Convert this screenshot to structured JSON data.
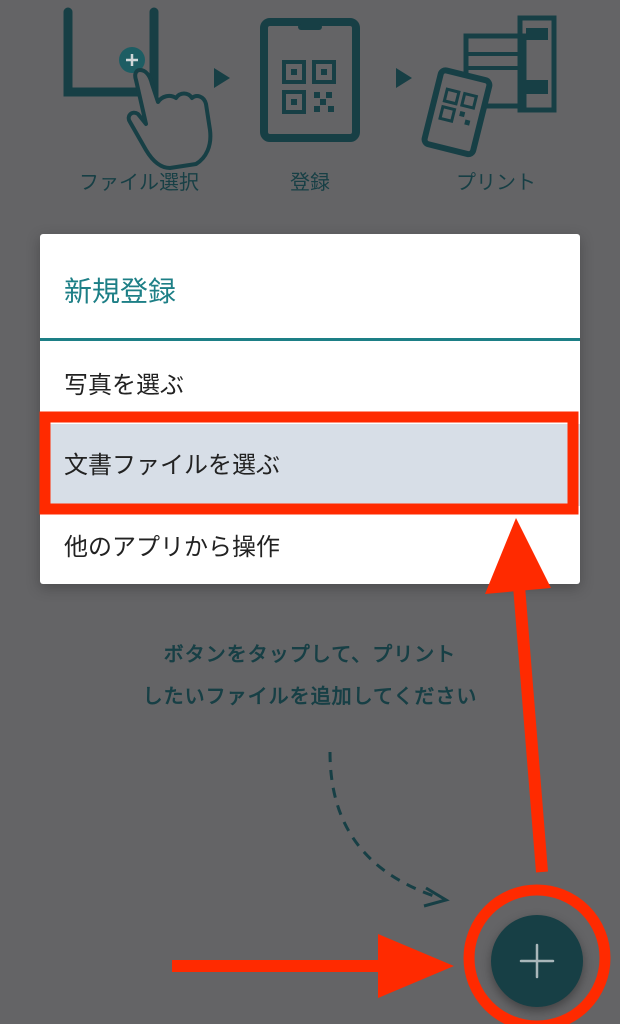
{
  "steps": [
    {
      "label": "ファイル選択"
    },
    {
      "label": "登録"
    },
    {
      "label": "プリント"
    }
  ],
  "dialog": {
    "title": "新規登録",
    "items": [
      {
        "label": "写真を選ぶ"
      },
      {
        "label": "文書ファイルを選ぶ",
        "highlighted": true
      },
      {
        "label": "他のアプリから操作"
      }
    ]
  },
  "hint": {
    "line1": "ボタンをタップして、プリント",
    "line2": "したいファイルを追加してください"
  },
  "fab": {
    "icon": "plus-icon"
  },
  "colors": {
    "accent": "#1d7f86",
    "dark_teal": "#173f45",
    "annotation_red": "#ff2a00",
    "overlay_gray": "#646466",
    "highlight_bg": "#d7dee7"
  }
}
